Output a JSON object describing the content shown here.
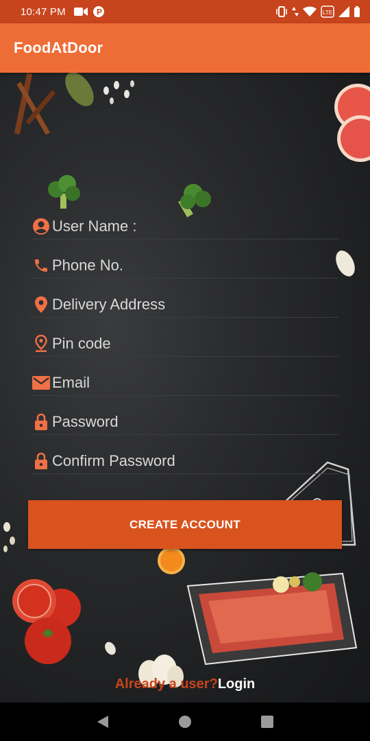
{
  "status_bar": {
    "time": "10:47 PM"
  },
  "app_bar": {
    "title": "FoodAtDoor"
  },
  "form": {
    "fields": [
      {
        "name": "username-field",
        "icon": "account-circle-icon",
        "placeholder": "User Name :"
      },
      {
        "name": "phone-field",
        "icon": "phone-icon",
        "placeholder": "Phone No."
      },
      {
        "name": "address-field",
        "icon": "location-pin-icon",
        "placeholder": "Delivery Address"
      },
      {
        "name": "pincode-field",
        "icon": "pin-drop-icon",
        "placeholder": "Pin code"
      },
      {
        "name": "email-field",
        "icon": "email-icon",
        "placeholder": "Email"
      },
      {
        "name": "password-field",
        "icon": "lock-icon",
        "placeholder": "Password"
      },
      {
        "name": "confirm-password-field",
        "icon": "lock-icon",
        "placeholder": "Confirm Password"
      }
    ]
  },
  "create_button": {
    "label": "CREATE ACCOUNT"
  },
  "login_prompt": {
    "question": "Already a user?",
    "link": "Login"
  },
  "colors": {
    "status_bar": "#c8441c",
    "app_bar": "#ee6d36",
    "accent": "#d9531f",
    "icon": "#ef7047",
    "field_text": "#d9d9d9"
  }
}
